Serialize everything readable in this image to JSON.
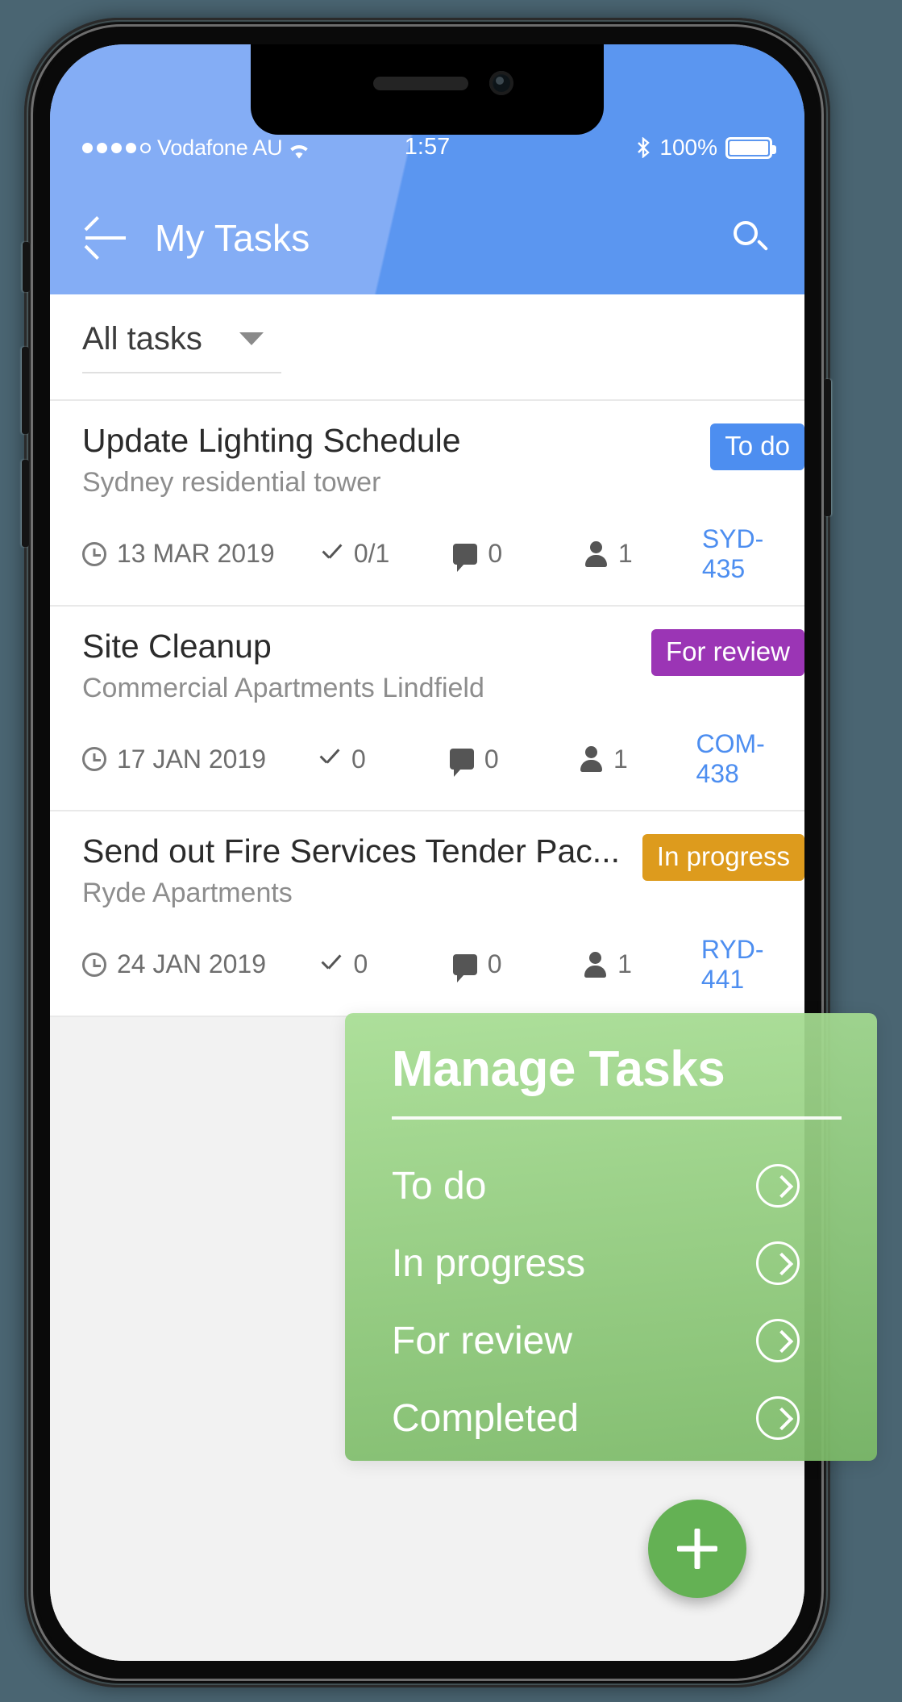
{
  "status_bar": {
    "signal_dots_filled": 4,
    "signal_dots_empty": 1,
    "carrier": "Vodafone AU",
    "wifi_icon": "wifi-icon",
    "time": "1:57",
    "bluetooth_icon": "bluetooth-icon",
    "battery_percent": "100%",
    "battery_icon": "battery-full-icon"
  },
  "appbar": {
    "back_icon": "back-arrow-icon",
    "title": "My Tasks",
    "search_icon": "search-icon",
    "background_color": "#5b96f0"
  },
  "filter": {
    "label": "All tasks",
    "caret_icon": "chevron-down-icon"
  },
  "meta_icons": {
    "date": "clock-icon",
    "checklist": "check-icon",
    "comments": "comment-icon",
    "assignees": "person-icon"
  },
  "tasks": [
    {
      "title": "Update Lighting Schedule",
      "subtitle": "Sydney residential tower",
      "status": "To do",
      "status_color": "#4d8ef0",
      "date": "13 MAR 2019",
      "checklist": "0/1",
      "comments": "0",
      "assignees": "1",
      "code": "SYD-435"
    },
    {
      "title": "Site Cleanup",
      "subtitle": "Commercial Apartments Lindfield",
      "status": "For review",
      "status_color": "#9b35b5",
      "date": "17 JAN 2019",
      "checklist": "0",
      "comments": "0",
      "assignees": "1",
      "code": "COM-438"
    },
    {
      "title": "Send out Fire Services Tender Pac...",
      "subtitle": "Ryde Apartments",
      "status": "In progress",
      "status_color": "#dd9b1d",
      "date": "24 JAN 2019",
      "checklist": "0",
      "comments": "0",
      "assignees": "1",
      "code": "RYD-441"
    }
  ],
  "overlay": {
    "title": "Manage Tasks",
    "accent_color": "#7cba68",
    "items": [
      {
        "label": "To do",
        "chevron": "chevron-right-circle-icon"
      },
      {
        "label": "In progress",
        "chevron": "chevron-right-circle-icon"
      },
      {
        "label": "For review",
        "chevron": "chevron-right-circle-icon"
      },
      {
        "label": "Completed",
        "chevron": "chevron-right-circle-icon"
      }
    ]
  },
  "fab": {
    "icon": "plus-icon",
    "color": "#64b154"
  }
}
